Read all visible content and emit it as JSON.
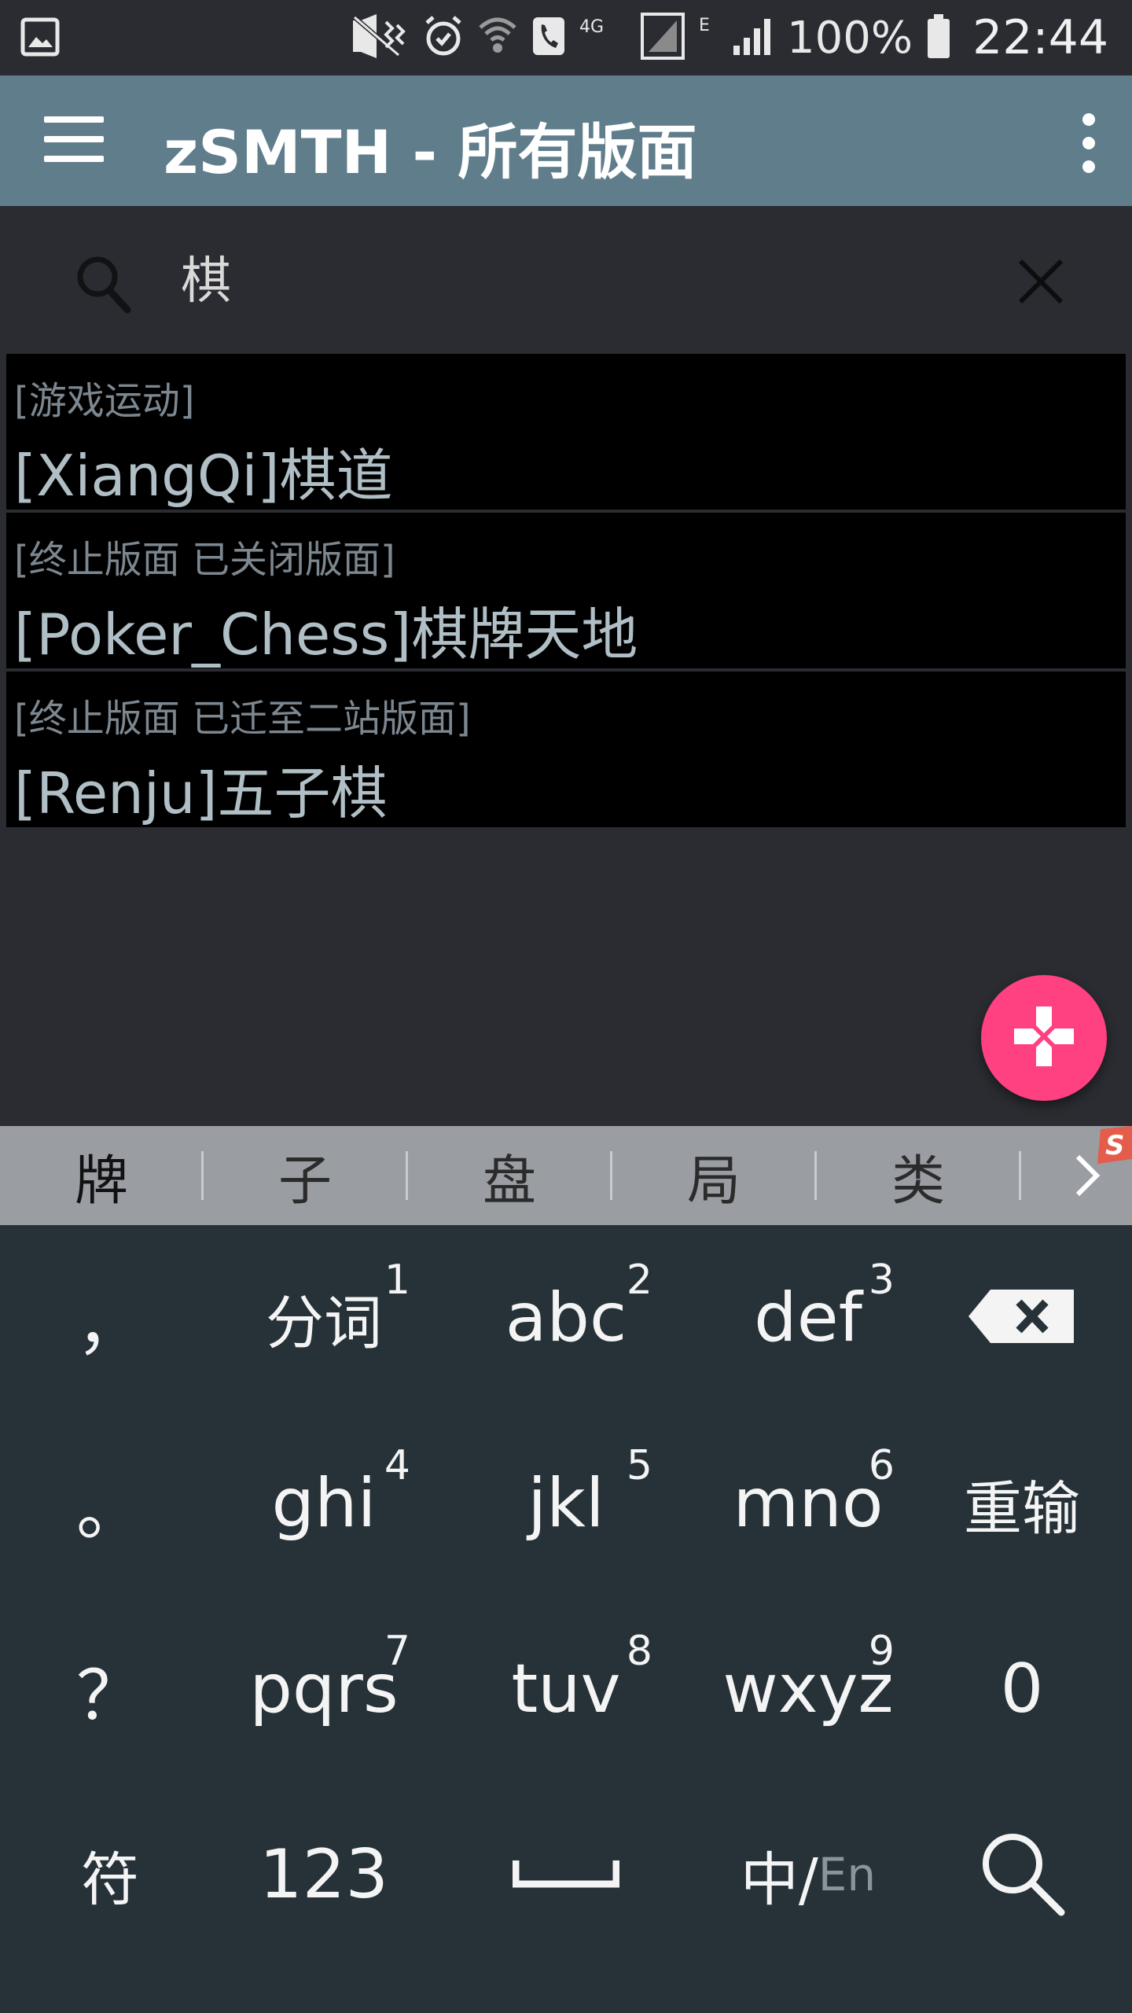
{
  "status_bar": {
    "icons": [
      "gallery-icon",
      "mute-vibrate-icon",
      "alarm-icon",
      "wifi-call-icon",
      "phone-icon",
      "4g-icon",
      "signal-icon",
      "edge-icon",
      "signal-icon",
      "battery-icon"
    ],
    "network_4g": "4G",
    "network_e": "E",
    "battery_pct": "100%",
    "time": "22:44"
  },
  "app_bar": {
    "title": "zSMTH - 所有版面",
    "menu_icon": "hamburger-menu-icon",
    "overflow_icon": "more-vert-icon",
    "background": "#607d8b"
  },
  "search": {
    "value": "棋",
    "search_icon": "search-icon",
    "clear_icon": "close-icon"
  },
  "results": [
    {
      "category": "[游戏运动]",
      "title": "[XiangQi]棋道"
    },
    {
      "category": "[终止版面 已关闭版面]",
      "title": "[Poker_Chess]棋牌天地"
    },
    {
      "category": "[终止版面 已迁至二站版面]",
      "title": "[Renju]五子棋"
    }
  ],
  "fab": {
    "icon": "gamepad-icon",
    "color": "#ff4081"
  },
  "keyboard": {
    "candidates": [
      "牌",
      "子",
      "盘",
      "局",
      "类"
    ],
    "more_icon": "chevron-right-icon",
    "rows": [
      [
        {
          "label": "，",
          "num": ""
        },
        {
          "label": "分词",
          "num": "1"
        },
        {
          "label": "abc",
          "num": "2"
        },
        {
          "label": "def",
          "num": "3"
        },
        {
          "label": "",
          "num": "",
          "icon": "backspace-icon"
        }
      ],
      [
        {
          "label": "。",
          "num": ""
        },
        {
          "label": "ghi",
          "num": "4"
        },
        {
          "label": "jkl",
          "num": "5"
        },
        {
          "label": "mno",
          "num": "6"
        },
        {
          "label": "重输",
          "num": ""
        }
      ],
      [
        {
          "label": "？",
          "num": ""
        },
        {
          "label": "pqrs",
          "num": "7"
        },
        {
          "label": "tuv",
          "num": "8"
        },
        {
          "label": "wxyz",
          "num": "9"
        },
        {
          "label": "0",
          "num": ""
        }
      ],
      [
        {
          "label": "符",
          "num": ""
        },
        {
          "label": "123",
          "num": ""
        },
        {
          "label": "",
          "num": "",
          "icon": "space-icon"
        },
        {
          "label": "中/",
          "sub": "En",
          "num": ""
        },
        {
          "label": "",
          "num": "",
          "icon": "search-icon"
        }
      ]
    ]
  }
}
